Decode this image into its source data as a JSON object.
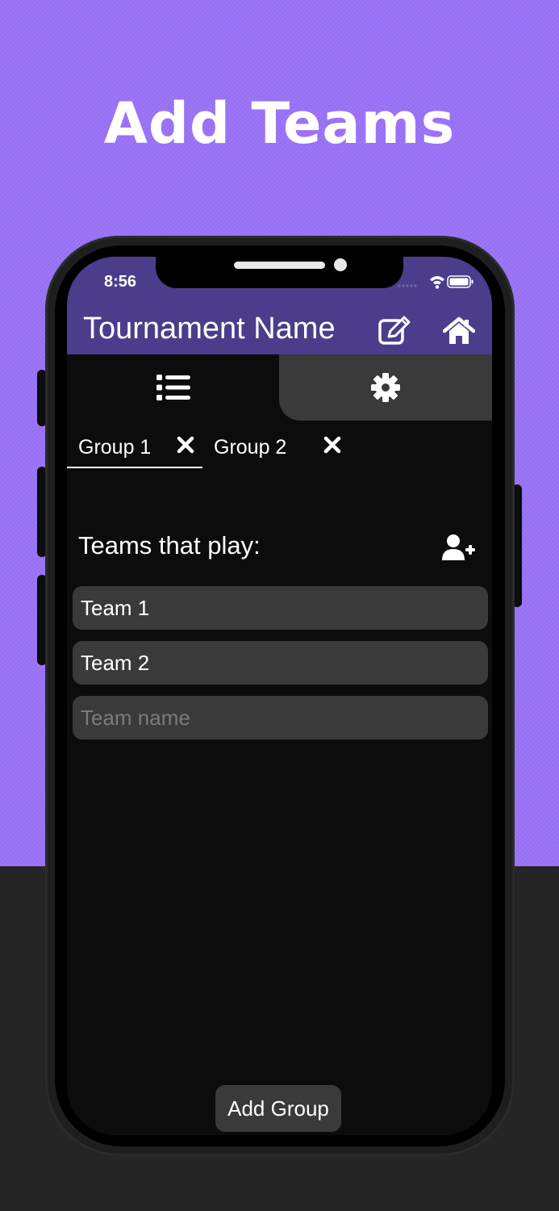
{
  "headline": "Add Teams",
  "status_bar": {
    "time": "8:56"
  },
  "header": {
    "title": "Tournament Name",
    "edit_icon": "edit-icon",
    "home_icon": "home-icon"
  },
  "tabs": [
    {
      "icon": "list-icon",
      "selected": true
    },
    {
      "icon": "gear-icon",
      "selected": false
    }
  ],
  "groups": [
    {
      "label": "Group 1",
      "selected": true
    },
    {
      "label": "Group 2",
      "selected": false
    }
  ],
  "section": {
    "label": "Teams that play:",
    "add_icon": "add-user-icon"
  },
  "teams": [
    {
      "name": "Team 1"
    },
    {
      "name": "Team 2"
    }
  ],
  "new_team": {
    "value": "",
    "placeholder": "Team name"
  },
  "add_group_label": "Add Group",
  "colors": {
    "background_top": "#9a72f8",
    "background_bottom": "#252525",
    "header": "#4b3d8c",
    "screen": "#0c0c0c",
    "pill": "#3a3a3a"
  }
}
